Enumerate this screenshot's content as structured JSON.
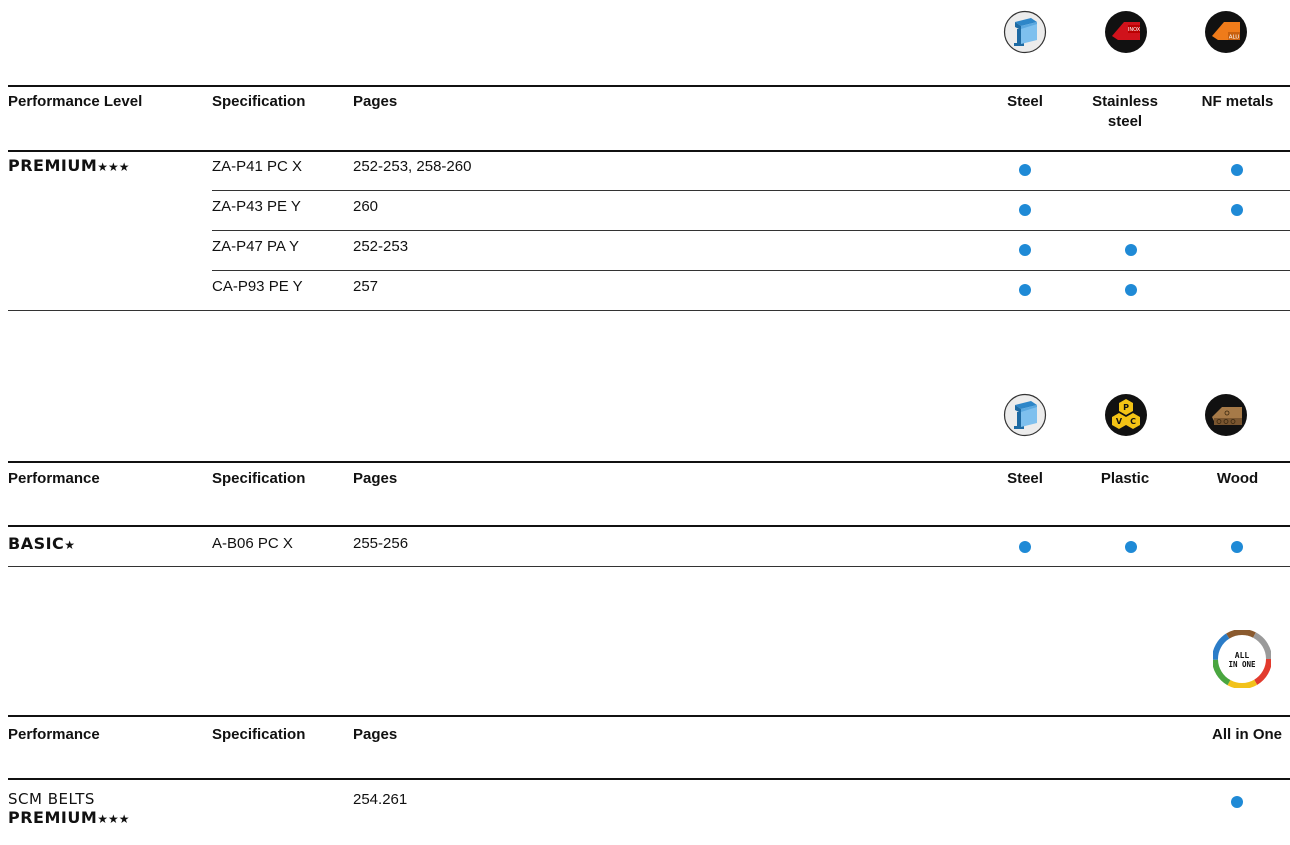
{
  "colors": {
    "dot": "#1f8ad6",
    "rule": "#111111"
  },
  "section1": {
    "icons": [
      "steel-beam-icon",
      "stainless-inox-icon",
      "aluminium-alu-icon"
    ],
    "icon_text": {
      "inox": "INOX",
      "alu": "ALU"
    },
    "headers": {
      "level": "Performance Level",
      "spec": "Specification",
      "pages": "Pages",
      "c1": "Steel",
      "c2_line1": "Stainless",
      "c2_line2": "steel",
      "c3": "NF metals"
    },
    "tier": {
      "name": "PREMIUM",
      "stars": "★★★"
    },
    "rows": [
      {
        "spec": "ZA-P41 PC X",
        "pages": "252-253, 258-260",
        "c1": true,
        "c2": false,
        "c3": true
      },
      {
        "spec": "ZA-P43 PE Y",
        "pages": "260",
        "c1": true,
        "c2": false,
        "c3": true
      },
      {
        "spec": "ZA-P47 PA Y",
        "pages": "252-253",
        "c1": true,
        "c2": true,
        "c3": false
      },
      {
        "spec": "CA-P93 PE Y",
        "pages": "257",
        "c1": true,
        "c2": true,
        "c3": false
      }
    ]
  },
  "section2": {
    "icons": [
      "steel-beam-icon",
      "pvc-plastic-icon",
      "wood-icon"
    ],
    "icon_text": {
      "p": "P",
      "v": "V",
      "c": "C"
    },
    "headers": {
      "level": "Performance",
      "spec": "Specification",
      "pages": "Pages",
      "c1": "Steel",
      "c2": "Plastic",
      "c3": "Wood"
    },
    "tier": {
      "name": "BASIC",
      "stars": "★"
    },
    "rows": [
      {
        "spec": "A-B06 PC X",
        "pages": "255-256",
        "c1": true,
        "c2": true,
        "c3": true
      }
    ]
  },
  "section3": {
    "icons": [
      "all-in-one-icon"
    ],
    "icon_text": {
      "line1": "ALL",
      "line2": "IN ONE"
    },
    "headers": {
      "level": "Performance",
      "spec": "Specification",
      "pages": "Pages",
      "c1": "All in One"
    },
    "row": {
      "name_line1": "SCM BELTS",
      "tier": "PREMIUM",
      "stars": "★★★",
      "pages": "254.261",
      "c1": true
    }
  }
}
